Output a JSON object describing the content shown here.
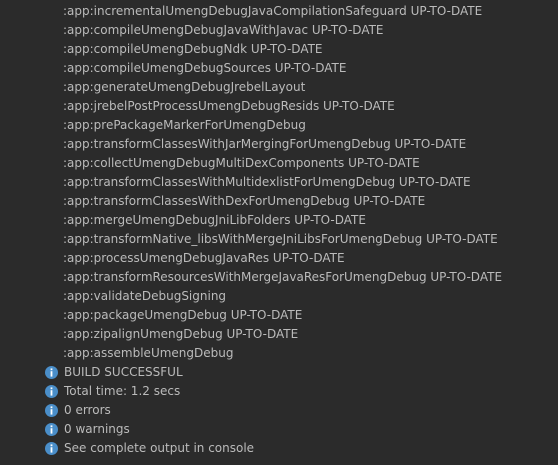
{
  "colors": {
    "background": "#2b2b2b",
    "text": "#bbbbbb",
    "info_icon": "#4a8ec9"
  },
  "icon": "info-icon",
  "tasks": [
    ":app:incrementalUmengDebugJavaCompilationSafeguard UP-TO-DATE",
    ":app:compileUmengDebugJavaWithJavac UP-TO-DATE",
    ":app:compileUmengDebugNdk UP-TO-DATE",
    ":app:compileUmengDebugSources UP-TO-DATE",
    ":app:generateUmengDebugJrebelLayout",
    ":app:jrebelPostProcessUmengDebugResids UP-TO-DATE",
    ":app:prePackageMarkerForUmengDebug",
    ":app:transformClassesWithJarMergingForUmengDebug UP-TO-DATE",
    ":app:collectUmengDebugMultiDexComponents UP-TO-DATE",
    ":app:transformClassesWithMultidexlistForUmengDebug UP-TO-DATE",
    ":app:transformClassesWithDexForUmengDebug UP-TO-DATE",
    ":app:mergeUmengDebugJniLibFolders UP-TO-DATE",
    ":app:transformNative_libsWithMergeJniLibsForUmengDebug UP-TO-DATE",
    ":app:processUmengDebugJavaRes UP-TO-DATE",
    ":app:transformResourcesWithMergeJavaResForUmengDebug UP-TO-DATE",
    ":app:validateDebugSigning",
    ":app:packageUmengDebug UP-TO-DATE",
    ":app:zipalignUmengDebug UP-TO-DATE",
    ":app:assembleUmengDebug"
  ],
  "summary": [
    "BUILD SUCCESSFUL",
    "Total time: 1.2 secs",
    "0 errors",
    "0 warnings",
    "See complete output in console"
  ]
}
